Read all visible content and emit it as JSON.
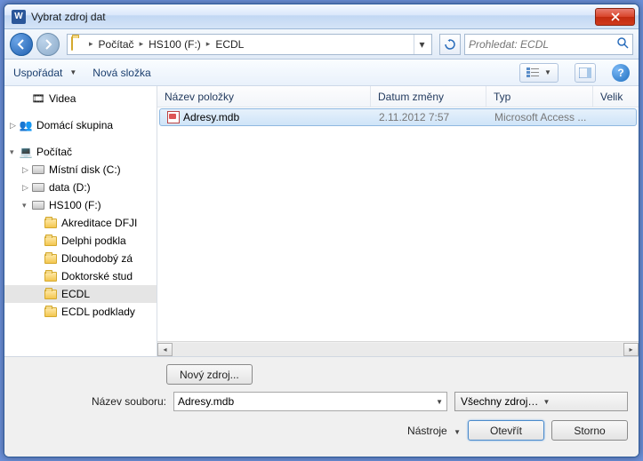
{
  "title": "Vybrat zdroj dat",
  "breadcrumb": {
    "seg1": "Počítač",
    "seg2": "HS100 (F:)",
    "seg3": "ECDL"
  },
  "search_placeholder": "Prohledat: ECDL",
  "toolbar": {
    "organize": "Uspořádat",
    "newfolder": "Nová složka"
  },
  "columns": {
    "name": "Název položky",
    "date": "Datum změny",
    "type": "Typ",
    "size": "Velik"
  },
  "tree": {
    "videa": "Videa",
    "homegroup": "Domácí skupina",
    "computer": "Počítač",
    "c": "Místní disk (C:)",
    "d": "data (D:)",
    "f": "HS100 (F:)",
    "akred": "Akreditace DFJI",
    "delphi": "Delphi podkla",
    "dlouh": "Dlouhodobý zá",
    "dokt": "Doktorské stud",
    "ecdl": "ECDL",
    "ecdlp": "ECDL podklady"
  },
  "file": {
    "name": "Adresy.mdb",
    "date": "2.11.2012 7:57",
    "type": "Microsoft Access ..."
  },
  "footer": {
    "newsource": "Nový zdroj...",
    "filename_label": "Název souboru:",
    "filename_value": "Adresy.mdb",
    "filter": "Všechny zdroje dat (*.odc;*.md",
    "tools": "Nástroje",
    "open": "Otevřít",
    "cancel": "Storno"
  }
}
